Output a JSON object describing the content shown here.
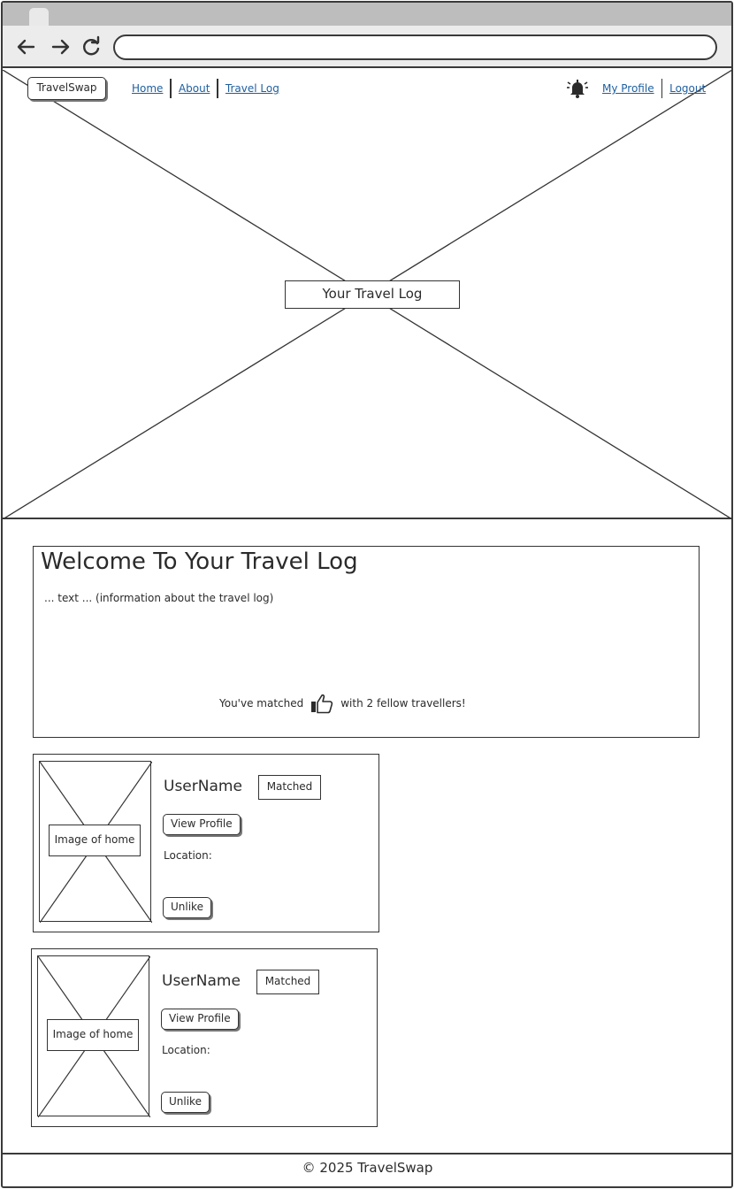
{
  "browser": {
    "back_icon": "arrow-left-icon",
    "forward_icon": "arrow-right-icon",
    "reload_icon": "reload-icon",
    "address_value": ""
  },
  "nav": {
    "brand": "TravelSwap",
    "links": [
      "Home",
      "About",
      "Travel Log"
    ],
    "notification_icon": "bell-icon",
    "right_links": [
      "My Profile",
      "Logout"
    ]
  },
  "hero": {
    "label": "Your Travel Log"
  },
  "welcome": {
    "title": "Welcome To Your Travel Log",
    "text": "... text ... (information about the travel log)",
    "matched_prefix": "You've matched",
    "matched_icon": "thumbs-up-icon",
    "matched_suffix": "with 2 fellow travellers!"
  },
  "matches": [
    {
      "image_label": "Image of home",
      "username": "UserName",
      "status": "Matched",
      "view_profile": "View Profile",
      "location_label": "Location:",
      "unlike": "Unlike"
    },
    {
      "image_label": "Image of home",
      "username": "UserName",
      "status": "Matched",
      "view_profile": "View Profile",
      "location_label": "Location:",
      "unlike": "Unlike"
    }
  ],
  "footer": {
    "text": "© 2025 TravelSwap"
  },
  "colors": {
    "link": "#1f5fa0",
    "stroke": "#333333",
    "chrome": "#ececec",
    "tabstrip": "#bdbdbd"
  }
}
